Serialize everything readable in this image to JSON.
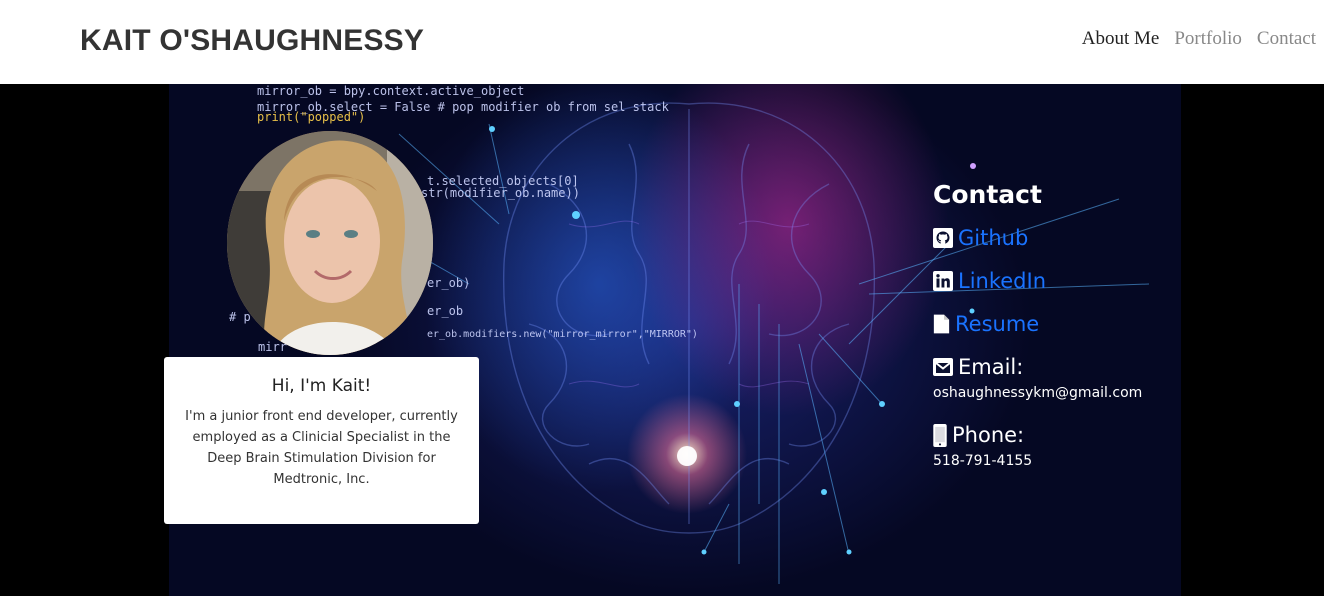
{
  "navbar": {
    "brand": "KAIT O'SHAUGHNESSY",
    "links": [
      {
        "label": "About Me",
        "active": true
      },
      {
        "label": "Portfolio",
        "active": false
      },
      {
        "label": "Contact",
        "active": false
      }
    ]
  },
  "background_code": [
    "mirror_ob = bpy.context.active_object",
    "mirror_ob.select = False # pop modifier ob from sel stack",
    "print(\"popped\")",
    "t.selected_objects[0]",
    "str(modifier_ob.name))",
    "er_ob)",
    "er_ob",
    "er_ob.modifiers.new(\"mirror_mirror\",\"MIRROR\")",
    "mirr",
    "# p"
  ],
  "intro_card": {
    "title": "Hi, I'm Kait!",
    "text": "I'm a junior front end developer, currently employed as a Clinicial Specialist in the Deep Brain Stimulation Division for Medtronic, Inc."
  },
  "contact": {
    "heading": "Contact",
    "github_label": "Github",
    "linkedin_label": "LinkedIn",
    "resume_label": "Resume",
    "email_label": "Email:",
    "email_value": "oshaughnessykm@gmail.com",
    "phone_label": "Phone:",
    "phone_value": "518-791-4155"
  },
  "colors": {
    "link_blue": "#1a73ff",
    "nav_active": "#222222",
    "nav_inactive": "#888888"
  },
  "icons": {
    "github": "github-icon",
    "linkedin": "linkedin-icon",
    "resume": "file-icon",
    "email": "envelope-icon",
    "phone": "mobile-phone-icon"
  }
}
